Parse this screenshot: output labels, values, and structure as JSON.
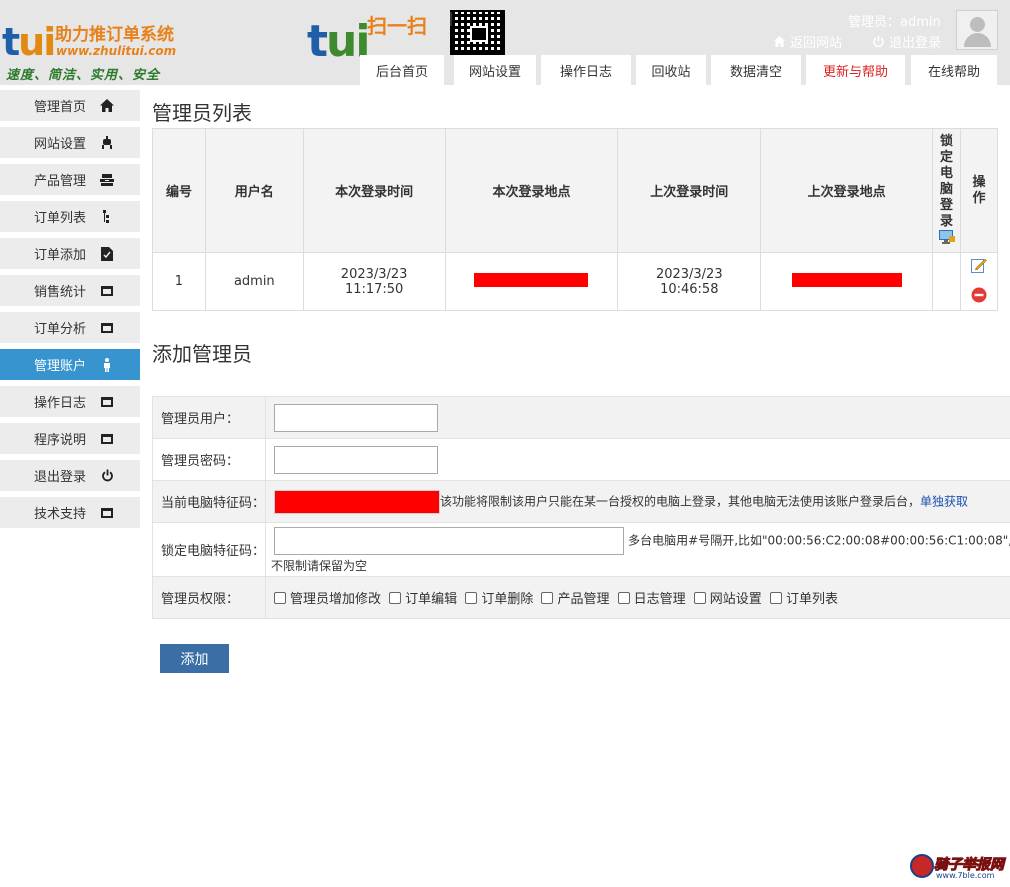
{
  "header": {
    "logo": {
      "tui": "tui",
      "title": "助力推订单系统",
      "url": "www.zhulitui.com",
      "slogan": "速度、简洁、实用、安全"
    },
    "logo2": {
      "tui": "tui",
      "scan": "扫一扫"
    },
    "admin_label": "管理员：admin",
    "back_link": "返回网站",
    "logout_link": "退出登录",
    "nav_tabs": [
      "后台首页",
      "网站设置",
      "操作日志",
      "回收站",
      "数据清空",
      "更新与帮助",
      "在线帮助"
    ]
  },
  "sidebar": {
    "items": [
      {
        "label": "管理首页",
        "icon": "home-icon"
      },
      {
        "label": "网站设置",
        "icon": "settings-icon"
      },
      {
        "label": "产品管理",
        "icon": "product-icon"
      },
      {
        "label": "订单列表",
        "icon": "list-icon"
      },
      {
        "label": "订单添加",
        "icon": "add-doc-icon"
      },
      {
        "label": "销售统计",
        "icon": "window-icon"
      },
      {
        "label": "订单分析",
        "icon": "window-icon"
      },
      {
        "label": "管理账户",
        "icon": "user-icon"
      },
      {
        "label": "操作日志",
        "icon": "window-icon"
      },
      {
        "label": "程序说明",
        "icon": "window-icon"
      },
      {
        "label": "退出登录",
        "icon": "power-icon"
      },
      {
        "label": "技术支持",
        "icon": "window-icon"
      }
    ],
    "active_index": 7,
    "active_color": "#3794cf"
  },
  "admin_list": {
    "title": "管理员列表",
    "columns": [
      "编号",
      "用户名",
      "本次登录时间",
      "本次登录地点",
      "上次登录时间",
      "上次登录地点",
      "锁定电脑登录",
      "操作"
    ],
    "rows": [
      {
        "id": "1",
        "username": "admin",
        "this_login_date": "2023/3/23",
        "this_login_time": "11:17:50",
        "last_login_date": "2023/3/23",
        "last_login_time": "10:46:58"
      }
    ]
  },
  "add_admin": {
    "title": "添加管理员",
    "username_label": "管理员用户：",
    "password_label": "管理员密码：",
    "pc_code_label": "当前电脑特征码：",
    "pc_code_hint": "该功能将限制该用户只能在某一台授权的电脑上登录，其他电脑无法使用该账户登录后台，",
    "pc_code_link": "单独获取",
    "lock_code_label": "锁定电脑特征码：",
    "lock_code_hint": "多台电脑用#号隔开,比如\"00:00:56:C2:00:08#00:00:56:C1:00:08\",",
    "lock_code_hint2": "不限制请保留为空",
    "perm_label": "管理员权限：",
    "permissions": [
      "管理员增加修改",
      "订单编辑",
      "订单删除",
      "产品管理",
      "日志管理",
      "网站设置",
      "订单列表"
    ],
    "submit_label": "添加"
  },
  "watermark": {
    "text": "骑子举报网",
    "url": "www.7ble.com"
  }
}
